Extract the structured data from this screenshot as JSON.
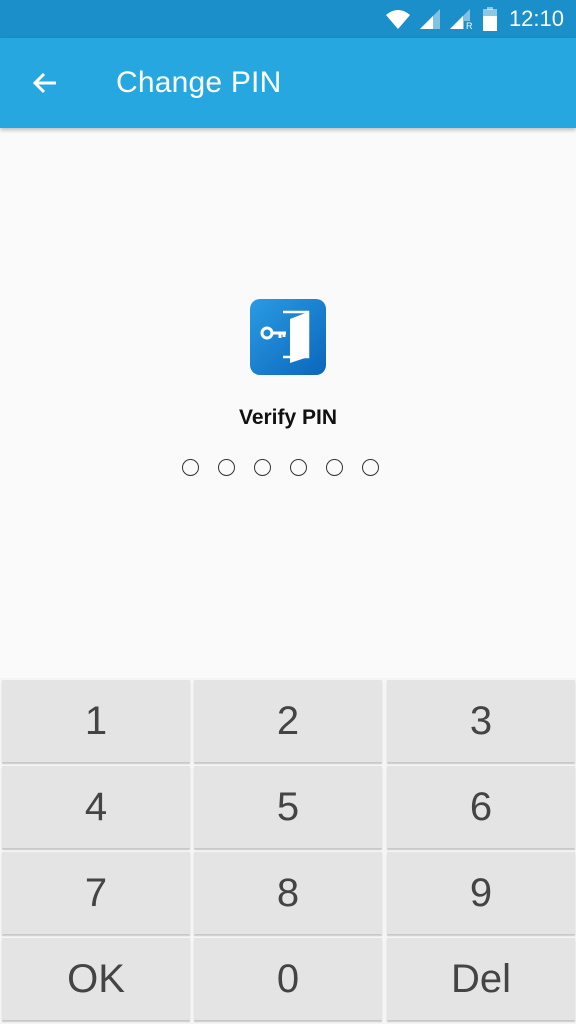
{
  "status_bar": {
    "time": "12:10",
    "icons": [
      "wifi-icon",
      "signal-icon",
      "signal-roaming-icon",
      "battery-icon"
    ],
    "roaming_label": "R"
  },
  "app_bar": {
    "title": "Change PIN",
    "back_icon": "arrow-left-icon",
    "color": "#27a7e0"
  },
  "main": {
    "logo_icon": "key-door-icon",
    "prompt": "Verify PIN",
    "pin_length": 6,
    "pin_entered": 0
  },
  "keypad": {
    "keys": [
      "1",
      "2",
      "3",
      "4",
      "5",
      "6",
      "7",
      "8",
      "9",
      "OK",
      "0",
      "Del"
    ]
  }
}
